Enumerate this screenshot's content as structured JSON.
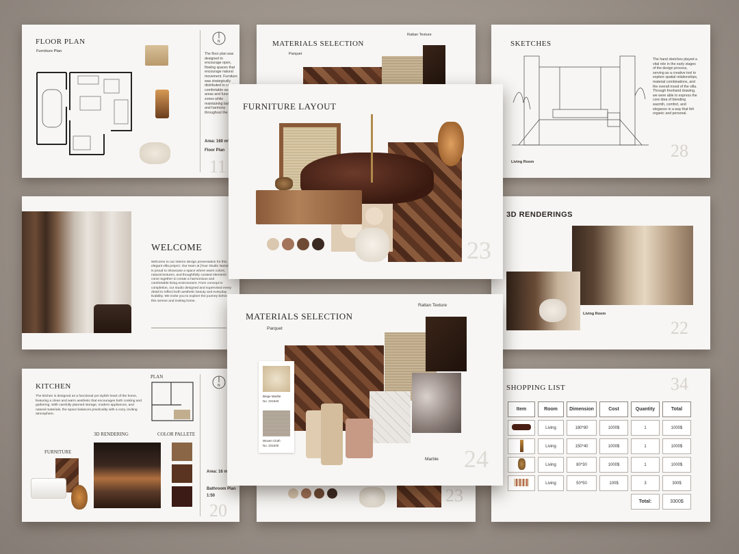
{
  "slides": {
    "floor_plan": {
      "title": "FLOOR PLAN",
      "subtitle": "Furniture Plan",
      "text": "The floor plan was designed to encourage open, flowing spaces that encourage natural movement. Furniture was strategically distributed to create comfortable seating areas and functional zones while maintaining balance and harmony throughout the villa.",
      "area": "Area: 160 m²",
      "label": "Floor Plan",
      "number": "11"
    },
    "materials_top": {
      "title": "MATERIALS SELECTION",
      "rattan": "Rattan Texture",
      "parquet": "Parquet"
    },
    "sketches": {
      "title": "SKETCHES",
      "text": "The hand sketches played a vital role in the early stages of the design process, serving as a creative tool to explore spatial relationships, material combinations, and the overall mood of the villa. Through freehand drawing, we were able to express the core idea of blending warmth, comfort, and elegance in a way that felt organic and personal.",
      "caption": "Living Room",
      "number": "28"
    },
    "welcome": {
      "title": "WELCOME",
      "text": "Welcome to our interior design presentation for this elegant villa project. Our team at [Your Studio Name] is proud to showcase a space where warm colors, natural textures, and thoughtfully curated elements come together to create a harmonious and comfortable living environment. From concept to completion, our studio designed and supervised every detail to reflect both aesthetic beauty and everyday livability. We invite you to explore the journey behind this serene and inviting home."
    },
    "furniture_layout": {
      "title": "FURNITURE LAYOUT",
      "number": "23",
      "swatches": [
        "#d9c7b0",
        "#a3735a",
        "#6e4a35",
        "#3b2a22"
      ]
    },
    "renderings": {
      "title": "3D RENDERINGS",
      "caption": "Living Room",
      "number": "22"
    },
    "kitchen": {
      "title": "KITCHEN",
      "text": "The kitchen is designed as a functional yet stylish heart of the home, featuring a clean and warm aesthetic that encourages both cooking and gathering. With carefully planned storage, modern appliances, and natural materials, the space balances practicality with a cozy, inviting atmosphere.",
      "plan": "PLAN",
      "rendering": "3D RENDERING",
      "palette": "COLOR PALLETE",
      "furniture": "FURNITURE",
      "area": "Area: 16 m²",
      "plan_label": "Bathroom Plan",
      "scale": "1:50",
      "number": "20",
      "palette_colors": [
        "#8a6646",
        "#5a3420",
        "#3c1a16"
      ]
    },
    "materials_main": {
      "title": "MATERIALS SELECTION",
      "rattan": "Rattan Texture",
      "parquet": "Parquet",
      "marble": "Marble",
      "beige_marble": "Beige Marble",
      "beige_code": "No. 221540",
      "woven_cloth": "Woven Cloth",
      "woven_code": "No. 221540",
      "number": "24"
    },
    "bottom_peek": {
      "number": "23",
      "swatches": [
        "#d9c7b0",
        "#a3735a",
        "#6e4a35",
        "#3b2a22"
      ]
    },
    "shopping": {
      "title": "SHOPPING LIST",
      "number": "34",
      "headers": [
        "Item",
        "Room",
        "Dimension",
        "Cost",
        "Quantity",
        "Total"
      ],
      "rows": [
        {
          "icon": "sofa-icon",
          "room": "Living",
          "dimension": "180*80",
          "cost": "1000$",
          "quantity": "1",
          "total": "1000$"
        },
        {
          "icon": "lamp-icon",
          "room": "Living",
          "dimension": "150*40",
          "cost": "1000$",
          "quantity": "1",
          "total": "1000$"
        },
        {
          "icon": "vase-icon",
          "room": "Living",
          "dimension": "80*30",
          "cost": "1000$",
          "quantity": "1",
          "total": "1000$"
        },
        {
          "icon": "pillow-icon",
          "room": "Living",
          "dimension": "50*50",
          "cost": "100$",
          "quantity": "3",
          "total": "300$"
        }
      ],
      "total_label": "Total:",
      "total_value": "3300$"
    }
  }
}
